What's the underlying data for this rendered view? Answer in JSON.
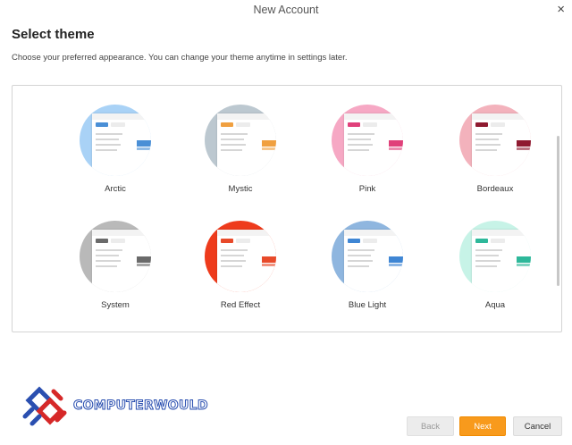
{
  "window": {
    "title": "New Account",
    "close_icon": "close-icon",
    "close_glyph": "×"
  },
  "page": {
    "heading": "Select theme",
    "description": "Choose your preferred appearance. You can change your theme anytime in settings later."
  },
  "themes": [
    {
      "label": "Arctic",
      "bg": "#a9d2f6",
      "accent": "#4a8fd6"
    },
    {
      "label": "Mystic",
      "bg": "#bcc8d0",
      "accent": "#f0a040"
    },
    {
      "label": "Pink",
      "bg": "#f6a8c4",
      "accent": "#e0407a"
    },
    {
      "label": "Bordeaux",
      "bg": "#f3b2bc",
      "accent": "#8f1a30"
    },
    {
      "label": "System",
      "bg": "#b9b9b9",
      "accent": "#6a6a6a"
    },
    {
      "label": "Red Effect",
      "bg": "#ee3b1c",
      "accent": "#e84a2a"
    },
    {
      "label": "Blue Light",
      "bg": "#8fb6df",
      "accent": "#3f86d4"
    },
    {
      "label": "Aqua",
      "bg": "#c7f3e7",
      "accent": "#2eb89a"
    }
  ],
  "buttons": {
    "back": "Back",
    "next": "Next",
    "cancel": "Cancel"
  },
  "logo": {
    "text": "COMPUTERWOULD",
    "icon": "computerwould-logo-icon"
  }
}
